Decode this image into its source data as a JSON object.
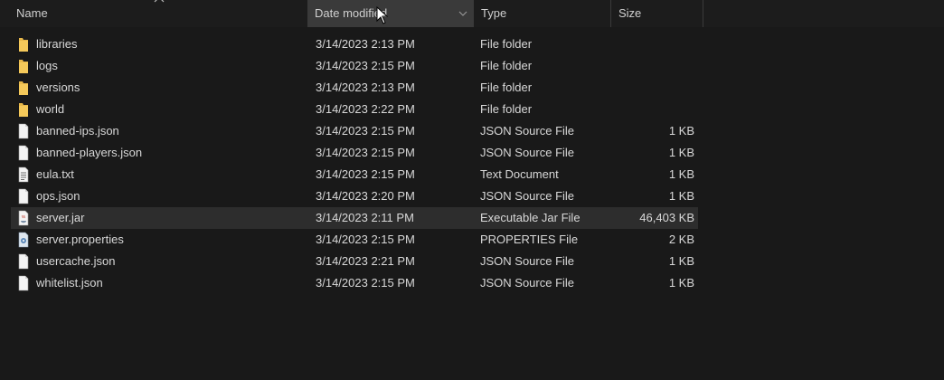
{
  "columns": {
    "name": "Name",
    "date": "Date modified",
    "type": "Type",
    "size": "Size"
  },
  "sort_icon": "chevron-up-icon",
  "colors": {
    "background": "#191919",
    "folder": "#e8b84a",
    "selected_row": "#2d2d2d"
  },
  "files": [
    {
      "name": "libraries",
      "date": "3/14/2023 2:13 PM",
      "type": "File folder",
      "size": "",
      "icon": "folder-icon"
    },
    {
      "name": "logs",
      "date": "3/14/2023 2:15 PM",
      "type": "File folder",
      "size": "",
      "icon": "folder-icon"
    },
    {
      "name": "versions",
      "date": "3/14/2023 2:13 PM",
      "type": "File folder",
      "size": "",
      "icon": "folder-icon"
    },
    {
      "name": "world",
      "date": "3/14/2023 2:22 PM",
      "type": "File folder",
      "size": "",
      "icon": "folder-icon"
    },
    {
      "name": "banned-ips.json",
      "date": "3/14/2023 2:15 PM",
      "type": "JSON Source File",
      "size": "1 KB",
      "icon": "file-icon"
    },
    {
      "name": "banned-players.json",
      "date": "3/14/2023 2:15 PM",
      "type": "JSON Source File",
      "size": "1 KB",
      "icon": "file-icon"
    },
    {
      "name": "eula.txt",
      "date": "3/14/2023 2:15 PM",
      "type": "Text Document",
      "size": "1 KB",
      "icon": "text-file-icon"
    },
    {
      "name": "ops.json",
      "date": "3/14/2023 2:20 PM",
      "type": "JSON Source File",
      "size": "1 KB",
      "icon": "file-icon"
    },
    {
      "name": "server.jar",
      "date": "3/14/2023 2:11 PM",
      "type": "Executable Jar File",
      "size": "46,403 KB",
      "icon": "jar-file-icon",
      "selected": true
    },
    {
      "name": "server.properties",
      "date": "3/14/2023 2:15 PM",
      "type": "PROPERTIES File",
      "size": "2 KB",
      "icon": "properties-file-icon"
    },
    {
      "name": "usercache.json",
      "date": "3/14/2023 2:21 PM",
      "type": "JSON Source File",
      "size": "1 KB",
      "icon": "file-icon"
    },
    {
      "name": "whitelist.json",
      "date": "3/14/2023 2:15 PM",
      "type": "JSON Source File",
      "size": "1 KB",
      "icon": "file-icon"
    }
  ]
}
